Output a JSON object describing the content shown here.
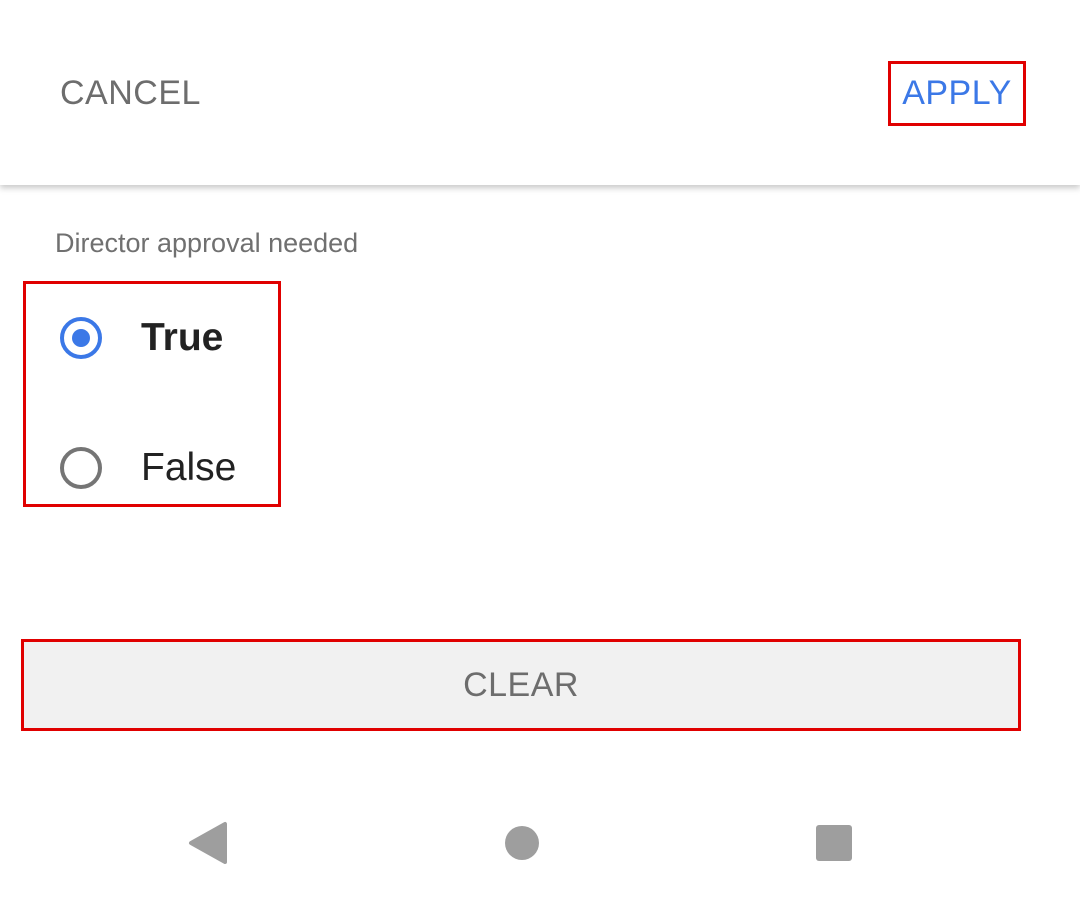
{
  "header": {
    "cancel_label": "CANCEL",
    "apply_label": "APPLY"
  },
  "filter": {
    "label": "Director approval needed",
    "options": [
      {
        "label": "True",
        "selected": true
      },
      {
        "label": "False",
        "selected": false
      }
    ]
  },
  "footer": {
    "clear_label": "CLEAR"
  },
  "navigation": {
    "back_icon": "back-triangle-icon",
    "home_icon": "home-circle-icon",
    "recent_icon": "recent-apps-square-icon"
  },
  "colors": {
    "accent": "#3b78e7",
    "highlight_border": "#e00000",
    "text_secondary": "#6d6d6d",
    "button_background": "#f1f1f1",
    "nav_icon": "#9e9e9e"
  }
}
